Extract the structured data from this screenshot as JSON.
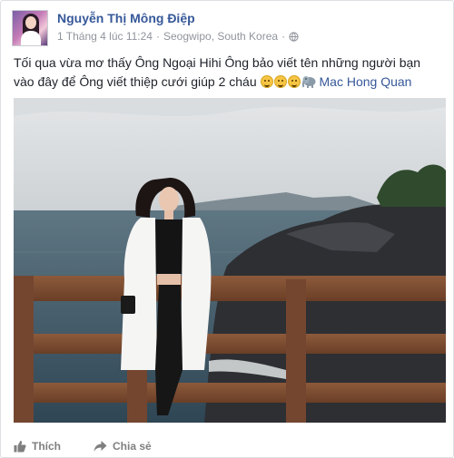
{
  "post": {
    "author": "Nguyễn Thị Mông Điệp",
    "date": "1 Tháng 4 lúc 11:24",
    "separator": "·",
    "location": "Seogwipo, South Korea",
    "privacy_icon": "globe-icon",
    "text": "Tối qua vừa mơ thấy Ông Ngoại Hihi Ông bảo viết tên những người bạn vào đây để Ông viết thiệp cưới giúp 2 cháu ",
    "emojis": [
      "laughing-face-icon",
      "laughing-face-icon",
      "laughing-face-icon",
      "elephant-icon"
    ],
    "mention": "Mac Hong Quan",
    "photo": "photo of woman in white coat standing at wooden railing above sea and rocky coast"
  },
  "actions": {
    "like_label": "Thích",
    "like_icon": "thumbs-up-icon",
    "share_label": "Chia sẻ",
    "share_icon": "share-arrow-icon"
  },
  "colors": {
    "link": "#365899",
    "meta": "#90949c",
    "action": "#7f7f7f",
    "border": "#dddfe2"
  }
}
